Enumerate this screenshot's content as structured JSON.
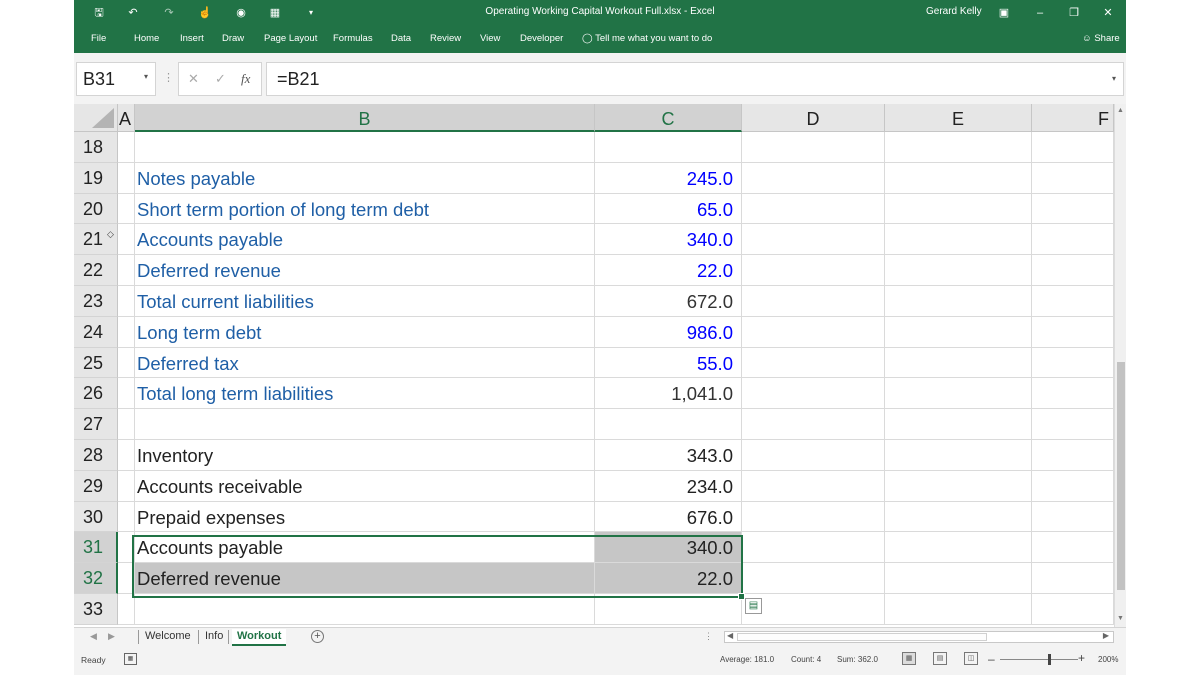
{
  "window": {
    "title": "Operating Working Capital Workout Full.xlsx  -  Excel",
    "user": "Gerard Kelly",
    "qat_icons": [
      "save-icon",
      "undo-icon",
      "redo-icon",
      "touch-mode-icon",
      "camera-icon",
      "calculator-icon",
      "customize-qat-icon"
    ],
    "window_controls": [
      "ribbon-display-icon",
      "minimize-icon",
      "restore-icon",
      "close-icon"
    ]
  },
  "ribbon": {
    "tabs": [
      "File",
      "Home",
      "Insert",
      "Draw",
      "Page Layout",
      "Formulas",
      "Data",
      "Review",
      "View",
      "Developer"
    ],
    "tell_me": "Tell me what you want to do",
    "share": "Share"
  },
  "formula_bar": {
    "name_box": "B31",
    "formula": "=B21"
  },
  "columns": [
    "A",
    "B",
    "C",
    "D",
    "E",
    "F"
  ],
  "selected_columns": [
    "B",
    "C"
  ],
  "rows": [
    {
      "num": "18",
      "label": "",
      "value": "",
      "label_style": "plain",
      "value_style": "plain"
    },
    {
      "num": "19",
      "label": "Notes payable",
      "value": "245.0",
      "label_style": "lbl",
      "value_style": "inp"
    },
    {
      "num": "20",
      "label": "Short term portion of long term debt",
      "value": "65.0",
      "label_style": "lbl",
      "value_style": "inp"
    },
    {
      "num": "21",
      "label": "Accounts payable",
      "value": "340.0",
      "label_style": "lbl",
      "value_style": "inp"
    },
    {
      "num": "22",
      "label": "Deferred revenue",
      "value": "22.0",
      "label_style": "lbl",
      "value_style": "inp"
    },
    {
      "num": "23",
      "label": "Total current liabilities",
      "value": "672.0",
      "label_style": "lbl",
      "value_style": "calc"
    },
    {
      "num": "24",
      "label": "Long term debt",
      "value": "986.0",
      "label_style": "lbl",
      "value_style": "inp"
    },
    {
      "num": "25",
      "label": "Deferred tax",
      "value": "55.0",
      "label_style": "lbl",
      "value_style": "inp"
    },
    {
      "num": "26",
      "label": "Total long term liabilities",
      "value": "1,041.0",
      "label_style": "lbl",
      "value_style": "calc"
    },
    {
      "num": "27",
      "label": "",
      "value": "",
      "label_style": "plain",
      "value_style": "plain"
    },
    {
      "num": "28",
      "label": "Inventory",
      "value": "343.0",
      "label_style": "plain",
      "value_style": "plain"
    },
    {
      "num": "29",
      "label": "Accounts receivable",
      "value": "234.0",
      "label_style": "plain",
      "value_style": "plain"
    },
    {
      "num": "30",
      "label": "Prepaid expenses",
      "value": "676.0",
      "label_style": "plain",
      "value_style": "plain"
    },
    {
      "num": "31",
      "label": "Accounts payable",
      "value": "340.0",
      "label_style": "plain",
      "value_style": "plain",
      "selected": true,
      "hl_label": false,
      "hl_value": true
    },
    {
      "num": "32",
      "label": "Deferred revenue",
      "value": "22.0",
      "label_style": "plain",
      "value_style": "plain",
      "selected": true,
      "hl_label": true,
      "hl_value": true
    },
    {
      "num": "33",
      "label": "",
      "value": "",
      "label_style": "plain",
      "value_style": "plain"
    }
  ],
  "sheets": {
    "tabs": [
      "Welcome",
      "Info",
      "Workout"
    ],
    "active": "Workout"
  },
  "status": {
    "ready": "Ready",
    "average": "Average: 181.0",
    "count": "Count: 4",
    "sum": "Sum: 362.0",
    "zoom": "200%"
  }
}
